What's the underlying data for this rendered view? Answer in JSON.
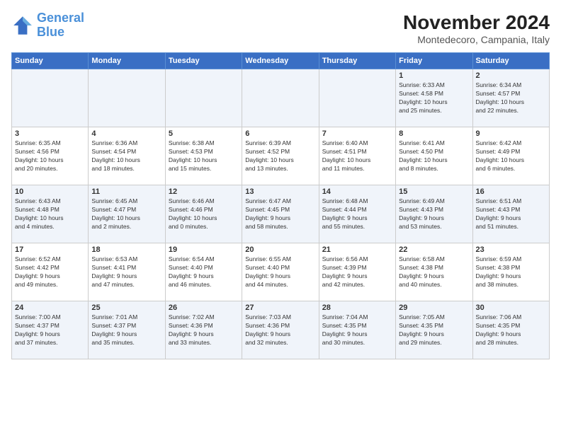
{
  "logo": {
    "line1": "General",
    "line2": "Blue"
  },
  "title": "November 2024",
  "location": "Montedecoro, Campania, Italy",
  "headers": [
    "Sunday",
    "Monday",
    "Tuesday",
    "Wednesday",
    "Thursday",
    "Friday",
    "Saturday"
  ],
  "weeks": [
    [
      {
        "day": "",
        "info": ""
      },
      {
        "day": "",
        "info": ""
      },
      {
        "day": "",
        "info": ""
      },
      {
        "day": "",
        "info": ""
      },
      {
        "day": "",
        "info": ""
      },
      {
        "day": "1",
        "info": "Sunrise: 6:33 AM\nSunset: 4:58 PM\nDaylight: 10 hours\nand 25 minutes."
      },
      {
        "day": "2",
        "info": "Sunrise: 6:34 AM\nSunset: 4:57 PM\nDaylight: 10 hours\nand 22 minutes."
      }
    ],
    [
      {
        "day": "3",
        "info": "Sunrise: 6:35 AM\nSunset: 4:56 PM\nDaylight: 10 hours\nand 20 minutes."
      },
      {
        "day": "4",
        "info": "Sunrise: 6:36 AM\nSunset: 4:54 PM\nDaylight: 10 hours\nand 18 minutes."
      },
      {
        "day": "5",
        "info": "Sunrise: 6:38 AM\nSunset: 4:53 PM\nDaylight: 10 hours\nand 15 minutes."
      },
      {
        "day": "6",
        "info": "Sunrise: 6:39 AM\nSunset: 4:52 PM\nDaylight: 10 hours\nand 13 minutes."
      },
      {
        "day": "7",
        "info": "Sunrise: 6:40 AM\nSunset: 4:51 PM\nDaylight: 10 hours\nand 11 minutes."
      },
      {
        "day": "8",
        "info": "Sunrise: 6:41 AM\nSunset: 4:50 PM\nDaylight: 10 hours\nand 8 minutes."
      },
      {
        "day": "9",
        "info": "Sunrise: 6:42 AM\nSunset: 4:49 PM\nDaylight: 10 hours\nand 6 minutes."
      }
    ],
    [
      {
        "day": "10",
        "info": "Sunrise: 6:43 AM\nSunset: 4:48 PM\nDaylight: 10 hours\nand 4 minutes."
      },
      {
        "day": "11",
        "info": "Sunrise: 6:45 AM\nSunset: 4:47 PM\nDaylight: 10 hours\nand 2 minutes."
      },
      {
        "day": "12",
        "info": "Sunrise: 6:46 AM\nSunset: 4:46 PM\nDaylight: 10 hours\nand 0 minutes."
      },
      {
        "day": "13",
        "info": "Sunrise: 6:47 AM\nSunset: 4:45 PM\nDaylight: 9 hours\nand 58 minutes."
      },
      {
        "day": "14",
        "info": "Sunrise: 6:48 AM\nSunset: 4:44 PM\nDaylight: 9 hours\nand 55 minutes."
      },
      {
        "day": "15",
        "info": "Sunrise: 6:49 AM\nSunset: 4:43 PM\nDaylight: 9 hours\nand 53 minutes."
      },
      {
        "day": "16",
        "info": "Sunrise: 6:51 AM\nSunset: 4:43 PM\nDaylight: 9 hours\nand 51 minutes."
      }
    ],
    [
      {
        "day": "17",
        "info": "Sunrise: 6:52 AM\nSunset: 4:42 PM\nDaylight: 9 hours\nand 49 minutes."
      },
      {
        "day": "18",
        "info": "Sunrise: 6:53 AM\nSunset: 4:41 PM\nDaylight: 9 hours\nand 47 minutes."
      },
      {
        "day": "19",
        "info": "Sunrise: 6:54 AM\nSunset: 4:40 PM\nDaylight: 9 hours\nand 46 minutes."
      },
      {
        "day": "20",
        "info": "Sunrise: 6:55 AM\nSunset: 4:40 PM\nDaylight: 9 hours\nand 44 minutes."
      },
      {
        "day": "21",
        "info": "Sunrise: 6:56 AM\nSunset: 4:39 PM\nDaylight: 9 hours\nand 42 minutes."
      },
      {
        "day": "22",
        "info": "Sunrise: 6:58 AM\nSunset: 4:38 PM\nDaylight: 9 hours\nand 40 minutes."
      },
      {
        "day": "23",
        "info": "Sunrise: 6:59 AM\nSunset: 4:38 PM\nDaylight: 9 hours\nand 38 minutes."
      }
    ],
    [
      {
        "day": "24",
        "info": "Sunrise: 7:00 AM\nSunset: 4:37 PM\nDaylight: 9 hours\nand 37 minutes."
      },
      {
        "day": "25",
        "info": "Sunrise: 7:01 AM\nSunset: 4:37 PM\nDaylight: 9 hours\nand 35 minutes."
      },
      {
        "day": "26",
        "info": "Sunrise: 7:02 AM\nSunset: 4:36 PM\nDaylight: 9 hours\nand 33 minutes."
      },
      {
        "day": "27",
        "info": "Sunrise: 7:03 AM\nSunset: 4:36 PM\nDaylight: 9 hours\nand 32 minutes."
      },
      {
        "day": "28",
        "info": "Sunrise: 7:04 AM\nSunset: 4:35 PM\nDaylight: 9 hours\nand 30 minutes."
      },
      {
        "day": "29",
        "info": "Sunrise: 7:05 AM\nSunset: 4:35 PM\nDaylight: 9 hours\nand 29 minutes."
      },
      {
        "day": "30",
        "info": "Sunrise: 7:06 AM\nSunset: 4:35 PM\nDaylight: 9 hours\nand 28 minutes."
      }
    ]
  ]
}
